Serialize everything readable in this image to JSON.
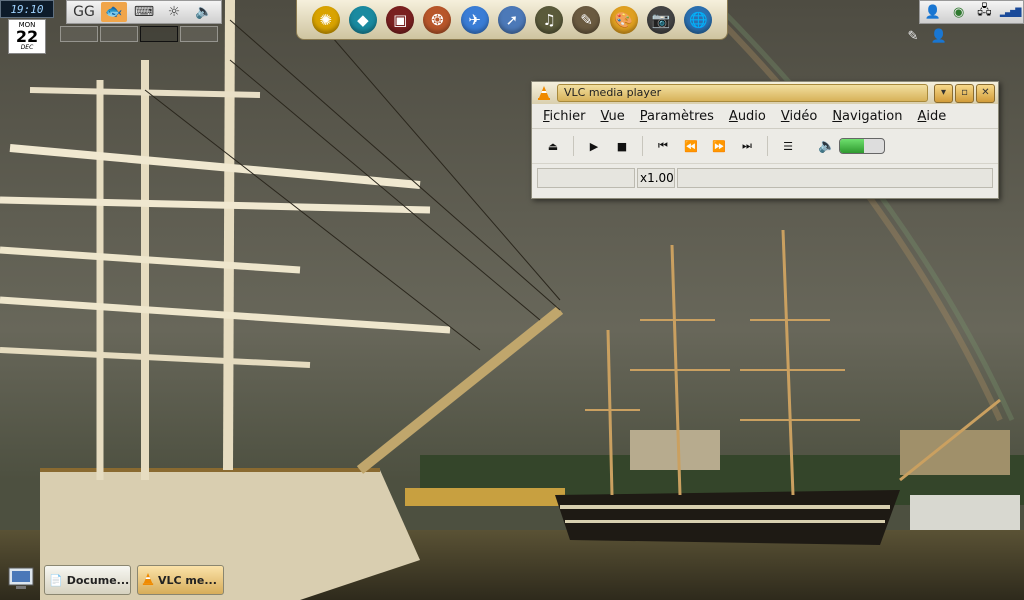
{
  "clock": {
    "time": "19:10"
  },
  "calendar": {
    "weekday": "MON",
    "day": "22",
    "month": "DEC"
  },
  "applets": [
    {
      "icon": "glasses-icon",
      "glyph": "GG"
    },
    {
      "icon": "fish-icon",
      "glyph": "🐟"
    },
    {
      "icon": "keyboard-icon",
      "glyph": "⌨"
    },
    {
      "icon": "brightness-icon",
      "glyph": "☼"
    },
    {
      "icon": "speaker-icon",
      "glyph": "🔈"
    }
  ],
  "dock": [
    {
      "icon": "sun-badge-icon",
      "glyph": "✺",
      "color": "#d9a300"
    },
    {
      "icon": "diamond-icon",
      "glyph": "◆",
      "color": "#1a8aa0"
    },
    {
      "icon": "terminal-icon",
      "glyph": "▣",
      "color": "#7a2020"
    },
    {
      "icon": "shell-icon",
      "glyph": "❂",
      "color": "#b8562a"
    },
    {
      "icon": "network-globe-icon",
      "glyph": "✈",
      "color": "#3a7dd6"
    },
    {
      "icon": "compass-icon",
      "glyph": "➚",
      "color": "#4c79b8"
    },
    {
      "icon": "media-icon",
      "glyph": "♫",
      "color": "#5a5a3a"
    },
    {
      "icon": "pen-icon",
      "glyph": "✎",
      "color": "#6a5a40"
    },
    {
      "icon": "palette-icon",
      "glyph": "🎨",
      "color": "#e0a020"
    },
    {
      "icon": "camera-icon",
      "glyph": "📷",
      "color": "#444444"
    },
    {
      "icon": "globe-icon",
      "glyph": "🌐",
      "color": "#2a70b0"
    }
  ],
  "tray": [
    {
      "icon": "user-icon",
      "glyph": "👤"
    },
    {
      "icon": "settings-globe-icon",
      "glyph": "◉"
    },
    {
      "icon": "devices-icon",
      "glyph": "🖧"
    },
    {
      "icon": "signal-icon",
      "glyph": "▂▄▆█"
    }
  ],
  "vlc": {
    "title": "VLC media player",
    "menu": [
      {
        "u": "F",
        "rest": "ichier"
      },
      {
        "u": "V",
        "rest": "ue"
      },
      {
        "u": "P",
        "rest": "aramètres"
      },
      {
        "u": "A",
        "rest": "udio"
      },
      {
        "u": "V",
        "rest": "idéo"
      },
      {
        "u": "N",
        "rest": "avigation"
      },
      {
        "u": "A",
        "rest": "ide"
      }
    ],
    "speed": "x1.00",
    "volume": 0.55,
    "accent": "#f08a00"
  },
  "taskbar": [
    {
      "label": "Docume...",
      "icon": "documents-icon"
    },
    {
      "label": "VLC me...",
      "icon": "vlc-cone-icon"
    }
  ]
}
